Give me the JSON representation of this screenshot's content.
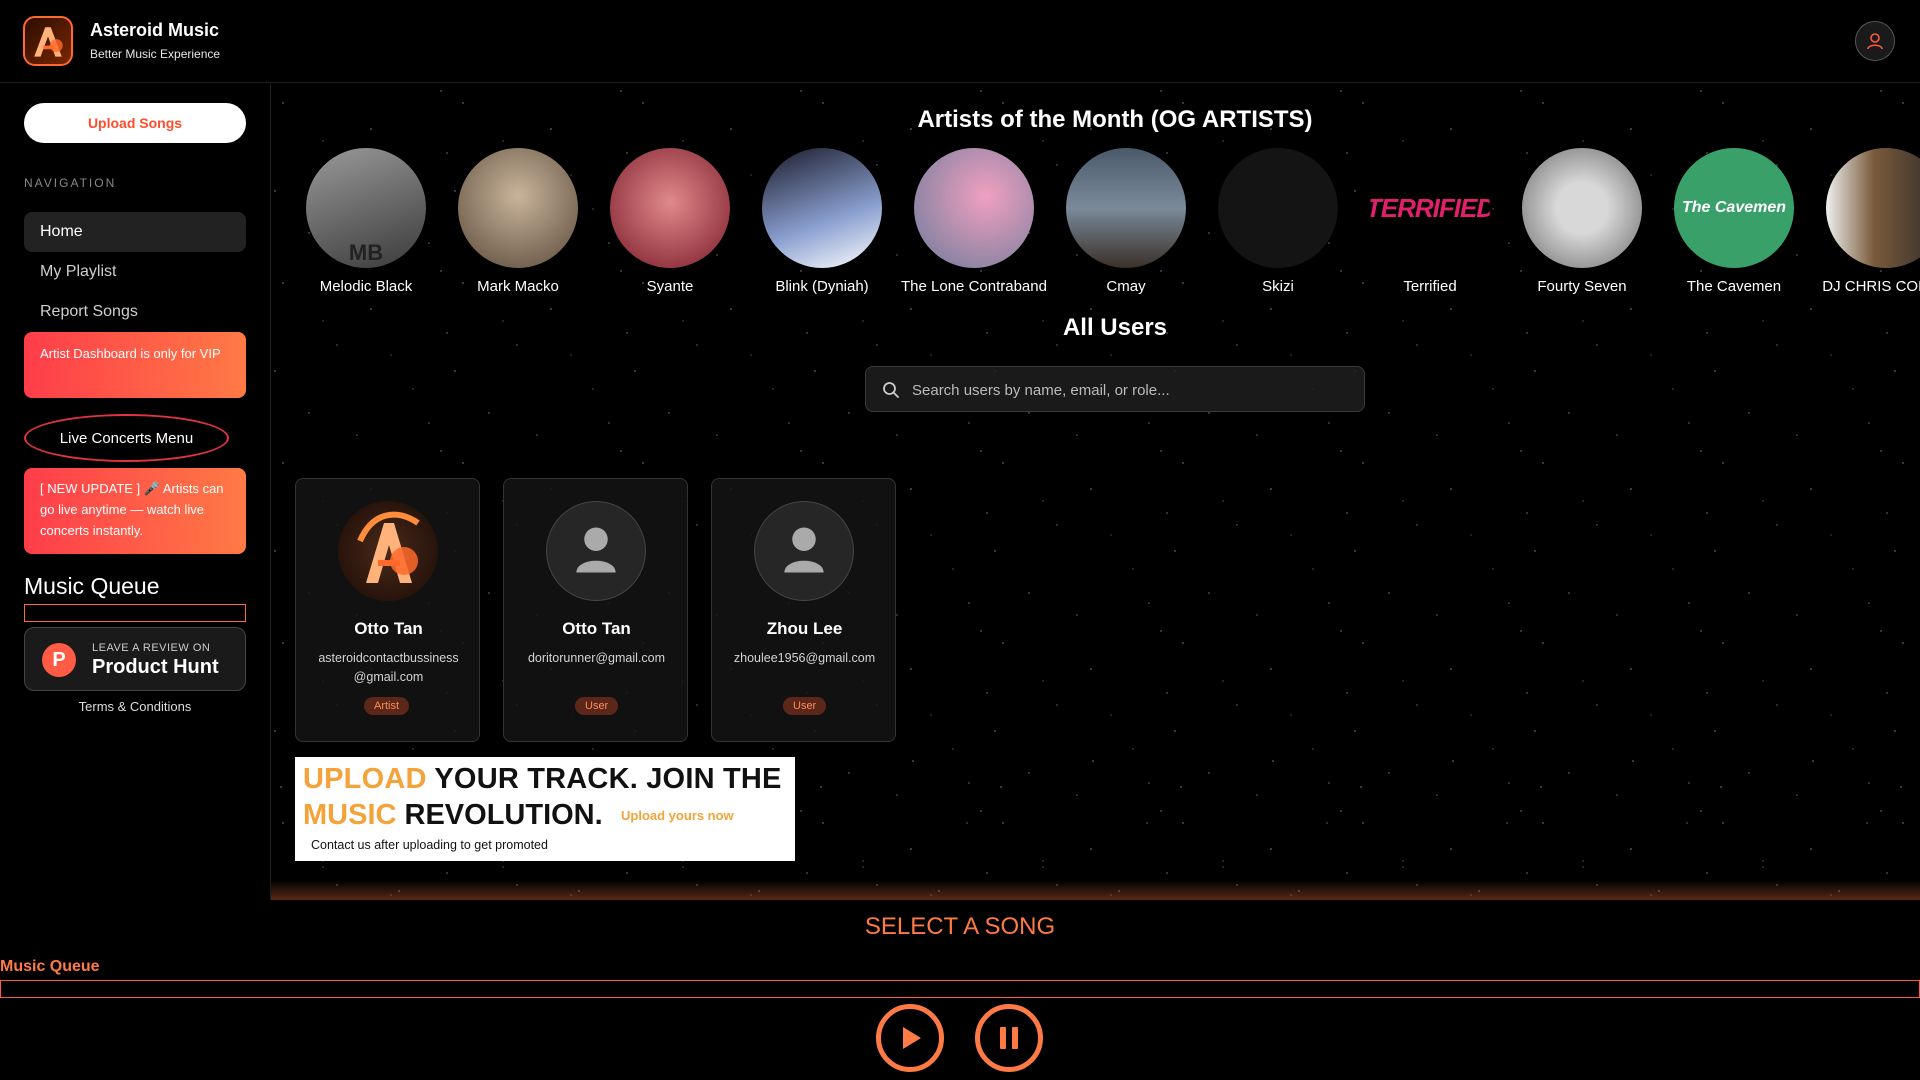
{
  "header": {
    "app_title": "Asteroid Music",
    "app_subtitle": "Better Music Experience"
  },
  "sidebar": {
    "upload_label": "Upload Songs",
    "nav_label": "NAVIGATION",
    "nav_items": [
      {
        "label": "Home",
        "active": true
      },
      {
        "label": "My Playlist",
        "active": false
      },
      {
        "label": "Report Songs",
        "active": false
      }
    ],
    "vip_notice": "Artist Dashboard is only for VIP",
    "live_concerts_label": "Live Concerts Menu",
    "update_notice": "[ NEW UPDATE ] 🎤 Artists can go live anytime — watch live concerts instantly.",
    "queue_title": "Music Queue",
    "product_hunt": {
      "small": "LEAVE A REVIEW ON",
      "big": "Product Hunt",
      "letter": "P"
    },
    "terms_label": "Terms & Conditions"
  },
  "main": {
    "artists_title": "Artists of the Month (OG ARTISTS)",
    "artists": [
      {
        "name": "Melodic Black",
        "bg": "#6b6b6b",
        "logo_text": "MB"
      },
      {
        "name": "Mark Macko",
        "bg": "#8a7a6a",
        "logo_text": ""
      },
      {
        "name": "Syante",
        "bg": "#a33a3a",
        "logo_text": ""
      },
      {
        "name": "Blink (Dyniah)",
        "bg": "#3a4a7a",
        "logo_text": ""
      },
      {
        "name": "The Lone Contraband",
        "bg": "#c04a6a",
        "logo_text": ""
      },
      {
        "name": "Cmay",
        "bg": "#5a6a7a",
        "logo_text": ""
      },
      {
        "name": "Skizi",
        "bg": "#161616",
        "logo_text": ""
      },
      {
        "name": "Terrified",
        "bg": "#000000",
        "logo_text": "TERRIFIED"
      },
      {
        "name": "Fourty Seven",
        "bg": "#bdbdbd",
        "logo_text": ""
      },
      {
        "name": "The Cavemen",
        "bg": "#3aa06a",
        "logo_text": "The Cavemen"
      },
      {
        "name": "DJ CHRIS CONCE",
        "bg": "#7a5a3a",
        "logo_text": ""
      }
    ],
    "users_title": "All Users",
    "search_placeholder": "Search users by name, email, or role...",
    "users": [
      {
        "name": "Otto Tan",
        "email": "asteroidcontactbussiness@gmail.com",
        "role": "Artist",
        "avatar": "asteroid"
      },
      {
        "name": "Otto Tan",
        "email": "doritorunner@gmail.com",
        "role": "User",
        "avatar": "default"
      },
      {
        "name": "Zhou Lee",
        "email": "zhoulee1956@gmail.com",
        "role": "User",
        "avatar": "default"
      }
    ],
    "promo": {
      "line1_accent": "UPLOAD",
      "line1_rest": " YOUR TRACK. JOIN THE",
      "line2_accent": "MUSIC",
      "line2_rest": " REVOLUTION.",
      "cta": "Upload yours now",
      "note": "Contact us after uploading to get promoted"
    }
  },
  "player": {
    "now_playing": "SELECT A SONG",
    "queue_label": "Music Queue"
  },
  "colors": {
    "accent": "#ff7a45",
    "accent_red": "#ff3d4a",
    "badge_bg": "#5a2718",
    "promo_orange": "#f3a33a"
  }
}
